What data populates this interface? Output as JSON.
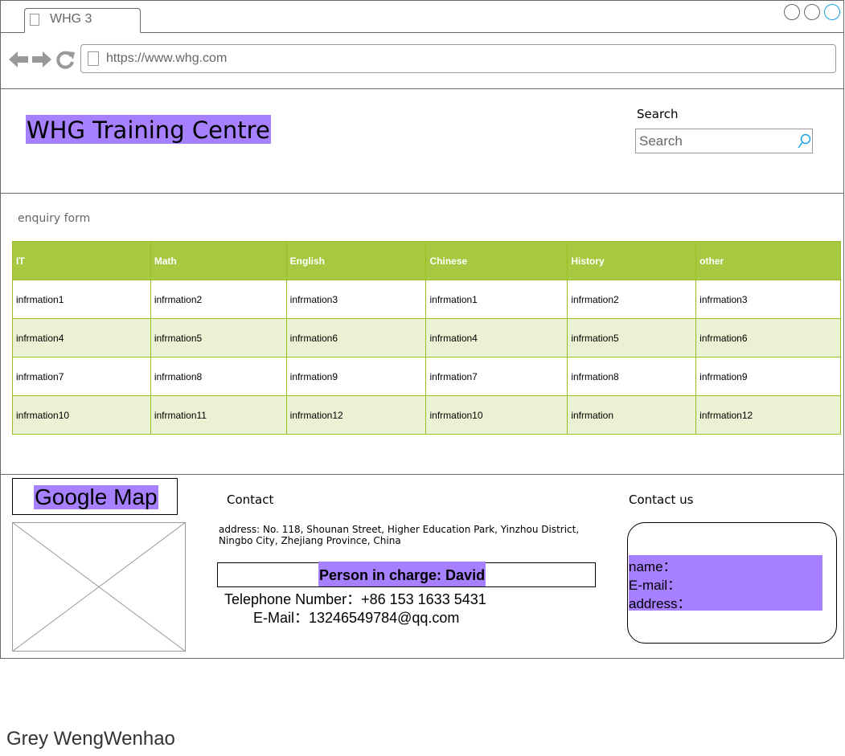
{
  "browser": {
    "tab_title": "WHG 3",
    "url": "https://www.whg.com"
  },
  "header": {
    "site_title": "WHG Training Centre",
    "search_label": "Search",
    "search_placeholder": "Search"
  },
  "enquiry": {
    "label": "enquiry form",
    "columns": [
      "IT",
      "Math",
      "English",
      "Chinese",
      "History",
      "other"
    ],
    "rows": [
      [
        "infrmation1",
        "infrmation2",
        "infrmation3",
        "infrmation1",
        "infrmation2",
        "infrmation3"
      ],
      [
        "infrmation4",
        "infrmation5",
        "infrmation6",
        "infrmation4",
        "infrmation5",
        "infrmation6"
      ],
      [
        "infrmation7",
        "infrmation8",
        "infrmation9",
        "infrmation7",
        "infrmation8",
        "infrmation9"
      ],
      [
        "infrmation10",
        "infrmation11",
        "infrmation12",
        "infrmation10",
        "infrmation",
        "infrmation12"
      ]
    ]
  },
  "footer": {
    "map_title": "Google Map",
    "contact": {
      "label": "Contact",
      "address": "address: No. 118, Shounan Street, Higher Education Park, Yinzhou District, Ningbo City, Zhejiang Province, China",
      "person": "Person in charge: David",
      "phone": "Telephone Number：+86 153 1633 5431",
      "email": "E-Mail：13246549784@qq.com"
    },
    "contact_us": {
      "label": "Contact us",
      "fields": [
        "name：",
        "E-mail：",
        "address："
      ]
    }
  },
  "author": "Grey  WengWenhao",
  "colors": {
    "highlight": "#a680ff",
    "table_header": "#a7c942",
    "table_alt_row": "#eaf2d3",
    "active_window_button": "#1ba1e2"
  }
}
